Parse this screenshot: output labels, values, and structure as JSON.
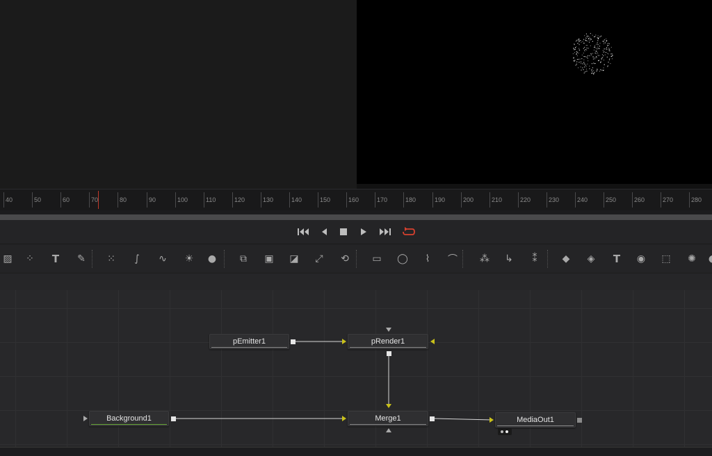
{
  "viewers": {
    "left": "viewer-1",
    "right": "viewer-2"
  },
  "timeline": {
    "ticks": [
      "40",
      "50",
      "60",
      "70",
      "80",
      "90",
      "100",
      "110",
      "120",
      "130",
      "140",
      "150",
      "160",
      "170",
      "180",
      "190",
      "200",
      "210",
      "220",
      "230",
      "240",
      "250",
      "260",
      "270",
      "280"
    ],
    "current_frame_marker": "70"
  },
  "transport": {
    "buttons": [
      "go-to-start",
      "step-back",
      "stop",
      "play",
      "go-to-end",
      "loop"
    ],
    "loop_color": "#d9412f"
  },
  "toolbar": {
    "tools": [
      "image-icon",
      "particles-icon",
      "text-icon",
      "paint-brush-icon",
      "blur-icon",
      "curves-icon",
      "color-corrector-icon",
      "brightness-contrast-icon",
      "droplet-icon",
      "merge-icon",
      "matte-control-icon",
      "mask-icon",
      "resize-icon",
      "transform-icon",
      "rectangle-mask-icon",
      "ellipse-mask-icon",
      "polygon-mask-icon",
      "bspline-mask-icon",
      "p-emitter-icon",
      "p-render-icon",
      "p-merge-icon",
      "shape-3d-icon",
      "merge-3d-icon",
      "text-3d-icon",
      "camera-3d-icon",
      "image-plane-3d-icon",
      "render-3d-icon",
      "light-3d-icon"
    ]
  },
  "nodes": {
    "pemitter": {
      "label": "pEmitter1"
    },
    "prender": {
      "label": "pRender1"
    },
    "background": {
      "label": "Background1"
    },
    "merge": {
      "label": "Merge1"
    },
    "mediaout": {
      "label": "MediaOut1"
    }
  },
  "colors": {
    "input_arrow": "#c9c11a",
    "background_underline": "#6aa83c",
    "playhead": "#c0392b"
  }
}
